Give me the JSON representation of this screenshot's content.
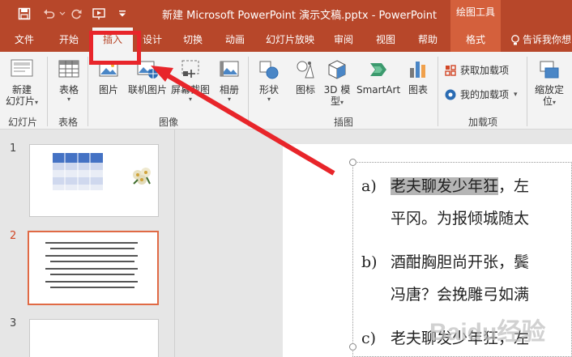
{
  "title_bar": {
    "document_title": "新建 Microsoft PowerPoint 演示文稿.pptx - PowerPoint",
    "contextual_group": "绘图工具"
  },
  "tabs": {
    "file": "文件",
    "home": "开始",
    "insert": "插入",
    "design": "设计",
    "transitions": "切换",
    "animations": "动画",
    "slideshow": "幻灯片放映",
    "review": "审阅",
    "view": "视图",
    "help": "帮助",
    "format": "格式",
    "tell_me": "告诉我你想"
  },
  "ribbon": {
    "new_slide_line1": "新建",
    "new_slide_line2": "幻灯片",
    "group_slides": "幻灯片",
    "table": "表格",
    "group_tables": "表格",
    "pictures": "图片",
    "online_pictures": "联机图片",
    "screenshot": "屏幕截图",
    "album": "相册",
    "group_images": "图像",
    "shapes": "形状",
    "icons": "图标",
    "model3d_line1": "3D 模",
    "model3d_line2": "型",
    "smartart": "SmartArt",
    "chart": "图表",
    "group_illustrations": "插图",
    "get_addins": "获取加载项",
    "my_addins": "我的加载项",
    "group_addins": "加载项",
    "zoom_line1": "缩放定",
    "zoom_line2": "位"
  },
  "thumbnails": {
    "slide1_number": "1",
    "slide2_number": "2",
    "slide3_number": "3"
  },
  "slide_content": {
    "line1_label": "a)",
    "line1_highlight": "老夫聊发少年狂",
    "line1_rest": "，左",
    "line2_text": "平冈。为报倾城随太",
    "line3_label": "b)",
    "line3_text": "酒酣胸胆尚开张，鬓",
    "line4_text": "冯唐？会挽雕弓如满",
    "line5_label": "c)",
    "line5_text": "老夫聊发少年狂，左"
  },
  "watermark_text": "Baidu经验",
  "colors": {
    "brand": "#b7472a",
    "contextual": "#d4603c",
    "annotation": "#e8252a"
  }
}
